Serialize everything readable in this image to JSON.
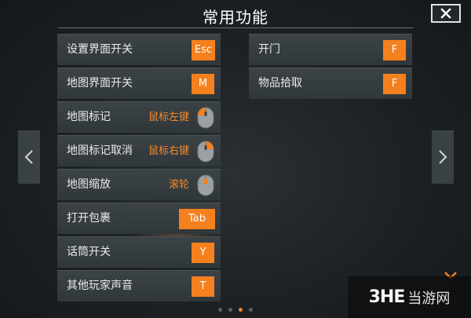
{
  "title": "常用功能",
  "accent_color": "#f5801e",
  "left_column": [
    {
      "label": "设置界面开关",
      "type": "key",
      "key": "Esc"
    },
    {
      "label": "地图界面开关",
      "type": "key",
      "key": "M"
    },
    {
      "label": "地图标记",
      "type": "mouse",
      "mouse_text": "鼠标左键",
      "mouse_part": "left"
    },
    {
      "label": "地图标记取消",
      "type": "mouse",
      "mouse_text": "鼠标右键",
      "mouse_part": "right"
    },
    {
      "label": "地图缩放",
      "type": "mouse",
      "mouse_text": "滚轮",
      "mouse_part": "wheel"
    },
    {
      "label": "打开包裹",
      "type": "key",
      "key": "Tab"
    },
    {
      "label": "话筒开关",
      "type": "key",
      "key": "Y"
    },
    {
      "label": "其他玩家声音",
      "type": "key",
      "key": "T"
    }
  ],
  "right_column": [
    {
      "label": "开门",
      "type": "key",
      "key": "F"
    },
    {
      "label": "物品拾取",
      "type": "key",
      "key": "F"
    }
  ],
  "pagination": {
    "total": 4,
    "current": 3
  },
  "watermark": {
    "mark": "3HE",
    "text": "当游网"
  },
  "icons": {
    "close": "close-icon",
    "prev": "chevron-left-icon",
    "next": "chevron-right-icon",
    "mouse": "mouse-icon"
  }
}
